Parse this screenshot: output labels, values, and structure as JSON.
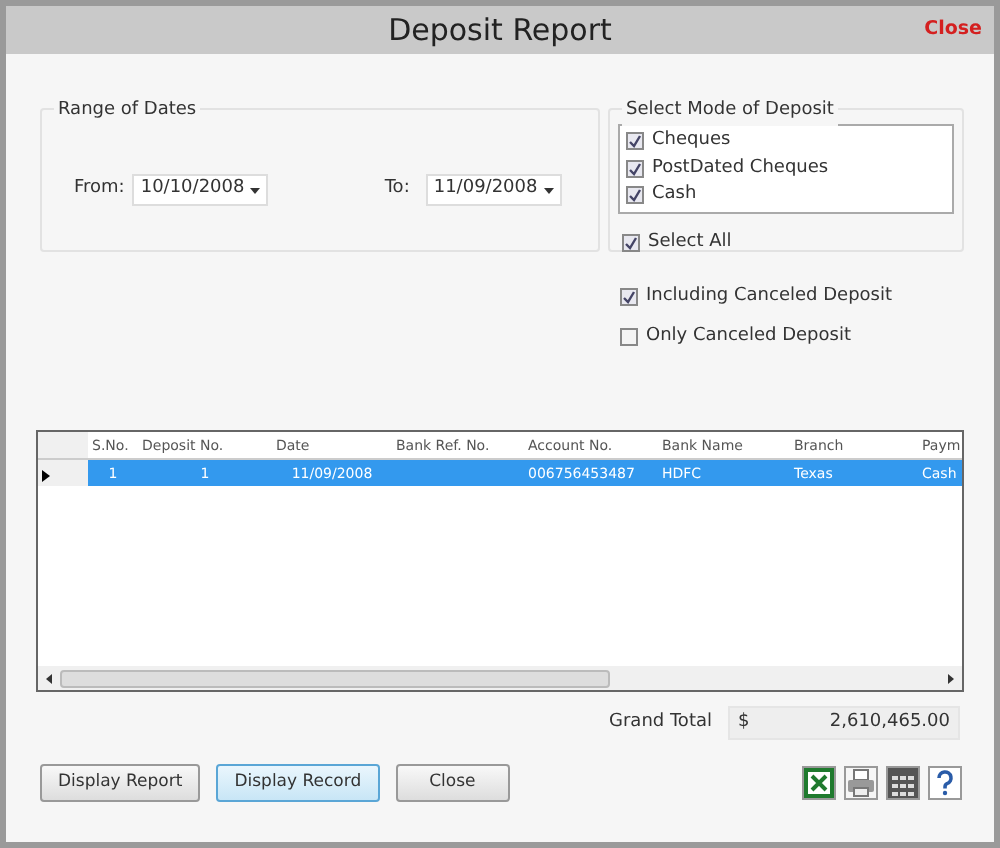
{
  "window": {
    "title": "Deposit Report",
    "close": "Close"
  },
  "date_range": {
    "legend": "Range of Dates",
    "from_label": "From:",
    "from_value": "10/10/2008",
    "to_label": "To:",
    "to_value": "11/09/2008"
  },
  "deposit_mode": {
    "legend": "Select Mode of Deposit",
    "options": [
      {
        "label": "Cheques",
        "checked": true
      },
      {
        "label": "PostDated Cheques",
        "checked": true
      },
      {
        "label": "Cash",
        "checked": true
      }
    ],
    "select_all": {
      "label": "Select All",
      "checked": true
    }
  },
  "filters": [
    {
      "label": "Including Canceled Deposit",
      "checked": true
    },
    {
      "label": "Only Canceled Deposit",
      "checked": false
    }
  ],
  "table": {
    "columns": [
      "S.No.",
      "Deposit No.",
      "Date",
      "Bank Ref. No.",
      "Account  No.",
      "Bank Name",
      "Branch",
      "Paym"
    ],
    "rows": [
      {
        "selected": true,
        "cells": [
          "1",
          "1",
          "11/09/2008",
          "",
          "006756453487",
          "HDFC",
          "Texas",
          "Cash"
        ]
      }
    ]
  },
  "grand_total": {
    "label": "Grand Total",
    "currency": "$",
    "value": "2,610,465.00"
  },
  "buttons": [
    {
      "label": "Display Report",
      "selected": false
    },
    {
      "label": "Display Record",
      "selected": true
    },
    {
      "label": "Close",
      "selected": false
    }
  ]
}
